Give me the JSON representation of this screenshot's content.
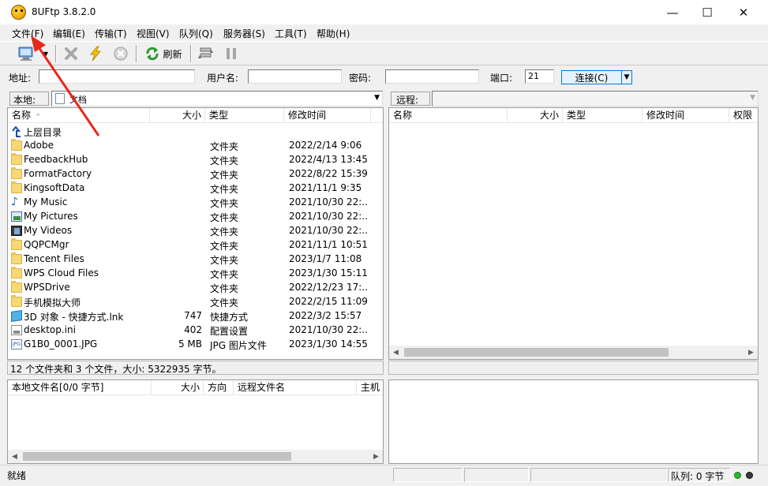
{
  "window": {
    "title": "8UFtp 3.8.2.0"
  },
  "window_controls": {
    "minimize": "—",
    "maximize": "☐",
    "close": "✕"
  },
  "menubar": {
    "items": [
      "文件(F)",
      "编辑(E)",
      "传输(T)",
      "视图(V)",
      "队列(Q)",
      "服务器(S)",
      "工具(T)",
      "帮助(H)"
    ]
  },
  "toolbar": {
    "refresh_label": "刷新"
  },
  "connect_bar": {
    "address_label": "地址:",
    "address_value": "",
    "user_label": "用户名:",
    "user_value": "",
    "password_label": "密码:",
    "password_value": "",
    "port_label": "端口:",
    "port_value": "21",
    "connect_label": "连接(C)"
  },
  "local": {
    "path_label": "本地:",
    "path_value": "文档",
    "columns": {
      "name": "名称",
      "size": "大小",
      "type": "类型",
      "modified": "修改时间"
    },
    "up_row": "上层目录",
    "rows": [
      {
        "icon": "folder-icon",
        "name": "Adobe",
        "size": "",
        "type": "文件夹",
        "modified": "2022/2/14 9:06"
      },
      {
        "icon": "folder-icon",
        "name": "FeedbackHub",
        "size": "",
        "type": "文件夹",
        "modified": "2022/4/13 13:45"
      },
      {
        "icon": "folder-icon",
        "name": "FormatFactory",
        "size": "",
        "type": "文件夹",
        "modified": "2022/8/22 15:39"
      },
      {
        "icon": "folder-icon",
        "name": "KingsoftData",
        "size": "",
        "type": "文件夹",
        "modified": "2021/11/1 9:35"
      },
      {
        "icon": "music-folder-icon",
        "name": "My Music",
        "size": "",
        "type": "文件夹",
        "modified": "2021/10/30 22:..."
      },
      {
        "icon": "pictures-folder-icon",
        "name": "My Pictures",
        "size": "",
        "type": "文件夹",
        "modified": "2021/10/30 22:..."
      },
      {
        "icon": "videos-folder-icon",
        "name": "My Videos",
        "size": "",
        "type": "文件夹",
        "modified": "2021/10/30 22:..."
      },
      {
        "icon": "folder-icon",
        "name": "QQPCMgr",
        "size": "",
        "type": "文件夹",
        "modified": "2021/11/1 10:51"
      },
      {
        "icon": "folder-icon",
        "name": "Tencent Files",
        "size": "",
        "type": "文件夹",
        "modified": "2023/1/7 11:08"
      },
      {
        "icon": "folder-icon",
        "name": "WPS Cloud Files",
        "size": "",
        "type": "文件夹",
        "modified": "2023/1/30 15:11"
      },
      {
        "icon": "folder-icon",
        "name": "WPSDrive",
        "size": "",
        "type": "文件夹",
        "modified": "2022/12/23 17:..."
      },
      {
        "icon": "folder-icon",
        "name": "手机模拟大师",
        "size": "",
        "type": "文件夹",
        "modified": "2022/2/15 11:09"
      },
      {
        "icon": "shortcut-3d-icon",
        "name": "3D 对象 - 快捷方式.lnk",
        "size": "747",
        "type": "快捷方式",
        "modified": "2022/3/2 15:57"
      },
      {
        "icon": "ini-file-icon",
        "name": "desktop.ini",
        "size": "402",
        "type": "配置设置",
        "modified": "2021/10/30 22:..."
      },
      {
        "icon": "jpg-file-icon",
        "name": "G1B0_0001.JPG",
        "size": "5 MB",
        "type": "JPG 图片文件",
        "modified": "2023/1/30 14:55"
      }
    ],
    "summary": "12 个文件夹和 3 个文件，大小: 5322935 字节。"
  },
  "remote": {
    "path_label": "远程:",
    "path_value": "",
    "columns": {
      "name": "名称",
      "size": "大小",
      "type": "类型",
      "modified": "修改时间",
      "perm": "权限"
    }
  },
  "queue": {
    "columns": {
      "local": "本地文件名[0/0 字节]",
      "size": "大小",
      "direction": "方向",
      "remote": "远程文件名",
      "host": "主机"
    }
  },
  "statusbar": {
    "state": "就绪",
    "queue": "队列: 0 字节"
  },
  "colors": {
    "accent": "#0078d7",
    "annotation": "#e8271b",
    "folder": "#f8d775"
  }
}
